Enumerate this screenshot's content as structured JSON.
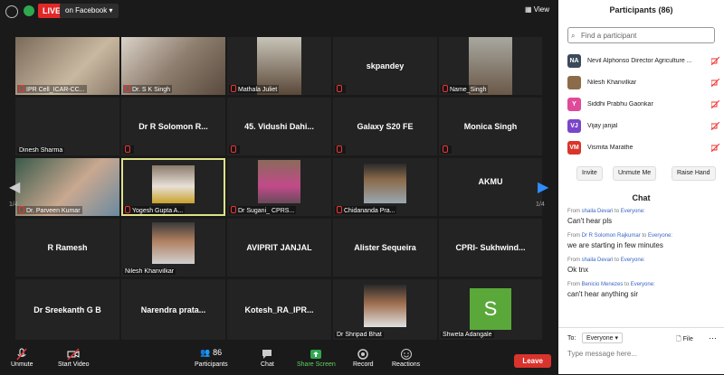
{
  "topbar": {
    "live": "LIVE",
    "facebook": "on Facebook",
    "view": "View"
  },
  "tiles": {
    "r1": [
      "IPR Cell_ICAR-CC...",
      "Dr. S K Singh",
      "Mathala Juliet",
      "skpandey",
      "Name_Singh"
    ],
    "r2": [
      "Dinesh Sharma",
      "Dr R  Solomon R...",
      "45. Vidushi Dahi...",
      "Galaxy S20 FE",
      "Monica Singh"
    ],
    "r3": [
      "Dr. Parveen Kumar",
      "Yogesh Gupta A...",
      "Dr Sugani_ CPRS...",
      "Chidananda Pra...",
      "AKMU"
    ],
    "r4": [
      "R Ramesh",
      "Nilesh Khanvilkar",
      "AVIPRIT JANJAL",
      "Alister Sequeira",
      "CPRI-  Sukhwind..."
    ],
    "r5": [
      "Dr Sreekanth G B",
      "Narendra  prata...",
      "Kotesh_RA_IPR...",
      "Dr Shripad Bhat",
      "Shweta Adangale"
    ],
    "avatar_s": "S",
    "page_left": "1/4",
    "page_right": "1/4"
  },
  "toolbar": {
    "unmute": "Unmute",
    "start_video": "Start Video",
    "participants": "Participants",
    "participants_count": "86",
    "chat": "Chat",
    "share": "Share Screen",
    "record": "Record",
    "reactions": "Reactions",
    "leave": "Leave"
  },
  "sidebar": {
    "title": "Participants (86)",
    "search_placeholder": "Find a participant",
    "participants": [
      {
        "initials": "NA",
        "name": "Nevil Alphonso Director Agriculture ...",
        "color": "#3b4a5a"
      },
      {
        "initials": "",
        "name": "Nilesh Khanvilkar",
        "color": "#8b6b4a"
      },
      {
        "initials": "Y",
        "name": "Siddhi Prabhu Gaonkar",
        "color": "#e04a9a"
      },
      {
        "initials": "VJ",
        "name": "Vijay janjal",
        "color": "#7a45c9"
      },
      {
        "initials": "VM",
        "name": "Vismita Marathe",
        "color": "#d8362b"
      }
    ],
    "buttons": [
      "Invite",
      "Unmute Me",
      "Raise Hand"
    ],
    "chat_title": "Chat",
    "messages": [
      {
        "from": "shaila Devari",
        "to": "Everyone:",
        "text": "Can't hear pls"
      },
      {
        "from": "Dr R Solomon Rajkumar",
        "to": "Everyone:",
        "text": "we are starting in few minutes"
      },
      {
        "from": "shaila Devari",
        "to": "Everyone:",
        "text": "Ok tnx"
      },
      {
        "from": "Benicio Menezes",
        "to": "Everyone:",
        "text": "can't hear  anything sir"
      }
    ],
    "to_label": "To:",
    "to_value": "Everyone",
    "file_label": "File",
    "message_placeholder": "Type message here..."
  }
}
